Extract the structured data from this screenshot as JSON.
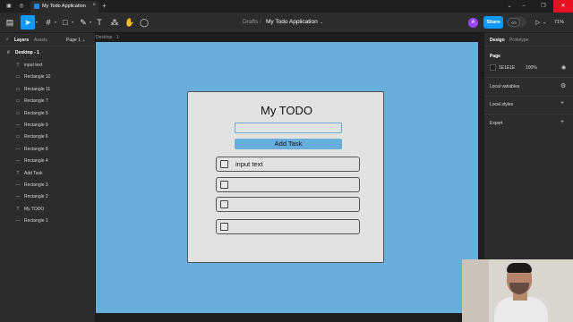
{
  "titlebar": {
    "tab_title": "My Todo Application",
    "tab_close": "×",
    "new_tab": "+",
    "minimize": "–",
    "maximize": "❐",
    "close": "✕",
    "icons": [
      "figma-menu-icon",
      "globe-icon",
      "folder-icon"
    ]
  },
  "toolbar": {
    "breadcrumb_drafts": "Drafts",
    "breadcrumb_sep": "/",
    "file_name": "My Todo Application",
    "file_caret": "⌄",
    "avatar_initial": "A",
    "share_label": "Share",
    "dev_mode_label": "</>",
    "zoom": "71%",
    "accent": "#0d99ff"
  },
  "left_panel": {
    "tab_layers": "Layers",
    "tab_assets": "Assets",
    "page_selector": "Page 1 ⌄",
    "frame_name": "Desktop - 1",
    "layers": [
      {
        "icon": "T",
        "name": "input text"
      },
      {
        "icon": "▭",
        "name": "Rectangle 10"
      },
      {
        "icon": "▭",
        "name": "Rectangle 11"
      },
      {
        "icon": "▭",
        "name": "Rectangle 7"
      },
      {
        "icon": "▭",
        "name": "Rectangle 5"
      },
      {
        "icon": "—",
        "name": "Rectangle 9"
      },
      {
        "icon": "▭",
        "name": "Rectangle 6"
      },
      {
        "icon": "—",
        "name": "Rectangle 8"
      },
      {
        "icon": "—",
        "name": "Rectangle 4"
      },
      {
        "icon": "T",
        "name": "Add Task"
      },
      {
        "icon": "—",
        "name": "Rectangle 3"
      },
      {
        "icon": "—",
        "name": "Rectangle 2"
      },
      {
        "icon": "T",
        "name": "My TODO"
      },
      {
        "icon": "—",
        "name": "Rectangle 1"
      }
    ]
  },
  "canvas": {
    "frame_label": "Desktop - 1",
    "bg_color": "#67aedb",
    "card": {
      "title": "My TODO",
      "add_button": "Add Task",
      "tasks": [
        {
          "text": "input text"
        },
        {
          "text": ""
        },
        {
          "text": ""
        },
        {
          "text": ""
        }
      ]
    }
  },
  "right_panel": {
    "tab_design": "Design",
    "tab_prototype": "Prototype",
    "page_heading": "Page",
    "page_color_hex": "1E1E1E",
    "page_opacity": "100%",
    "local_variables": "Local variables",
    "local_styles": "Local styles",
    "export": "Export",
    "add": "+"
  }
}
